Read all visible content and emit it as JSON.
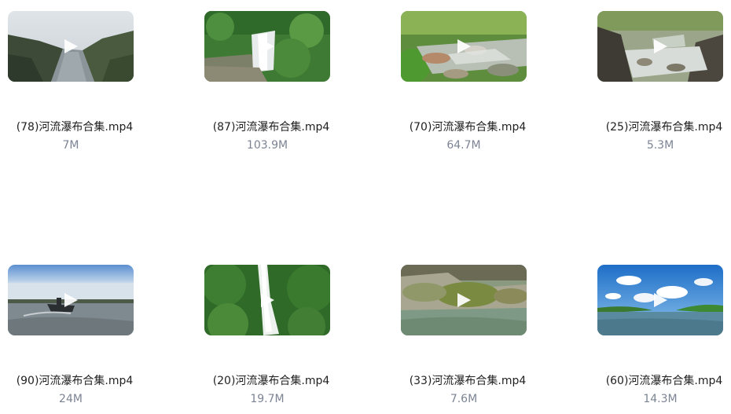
{
  "videos": [
    {
      "title": "(78)河流瀑布合集.mp4",
      "size": "7M",
      "thumbnail": "river-valley-aerial"
    },
    {
      "title": "(87)河流瀑布合集.mp4",
      "size": "103.9M",
      "thumbnail": "waterfall-forest-aerial"
    },
    {
      "title": "(70)河流瀑布合集.mp4",
      "size": "64.7M",
      "thumbnail": "mountain-stream-rocks"
    },
    {
      "title": "(25)河流瀑布合集.mp4",
      "size": "5.3M",
      "thumbnail": "rocky-creek"
    },
    {
      "title": "(90)河流瀑布合集.mp4",
      "size": "24M",
      "thumbnail": "boat-on-river"
    },
    {
      "title": "(20)河流瀑布合集.mp4",
      "size": "19.7M",
      "thumbnail": "jungle-waterfall"
    },
    {
      "title": "(33)河流瀑布合集.mp4",
      "size": "7.6M",
      "thumbnail": "mossy-rocks-river"
    },
    {
      "title": "(60)河流瀑布合集.mp4",
      "size": "14.3M",
      "thumbnail": "river-blue-sky-clouds"
    }
  ],
  "colors": {
    "title_text": "#1f1f1f",
    "size_text": "#7c8494",
    "play_icon": "#ffffff"
  }
}
